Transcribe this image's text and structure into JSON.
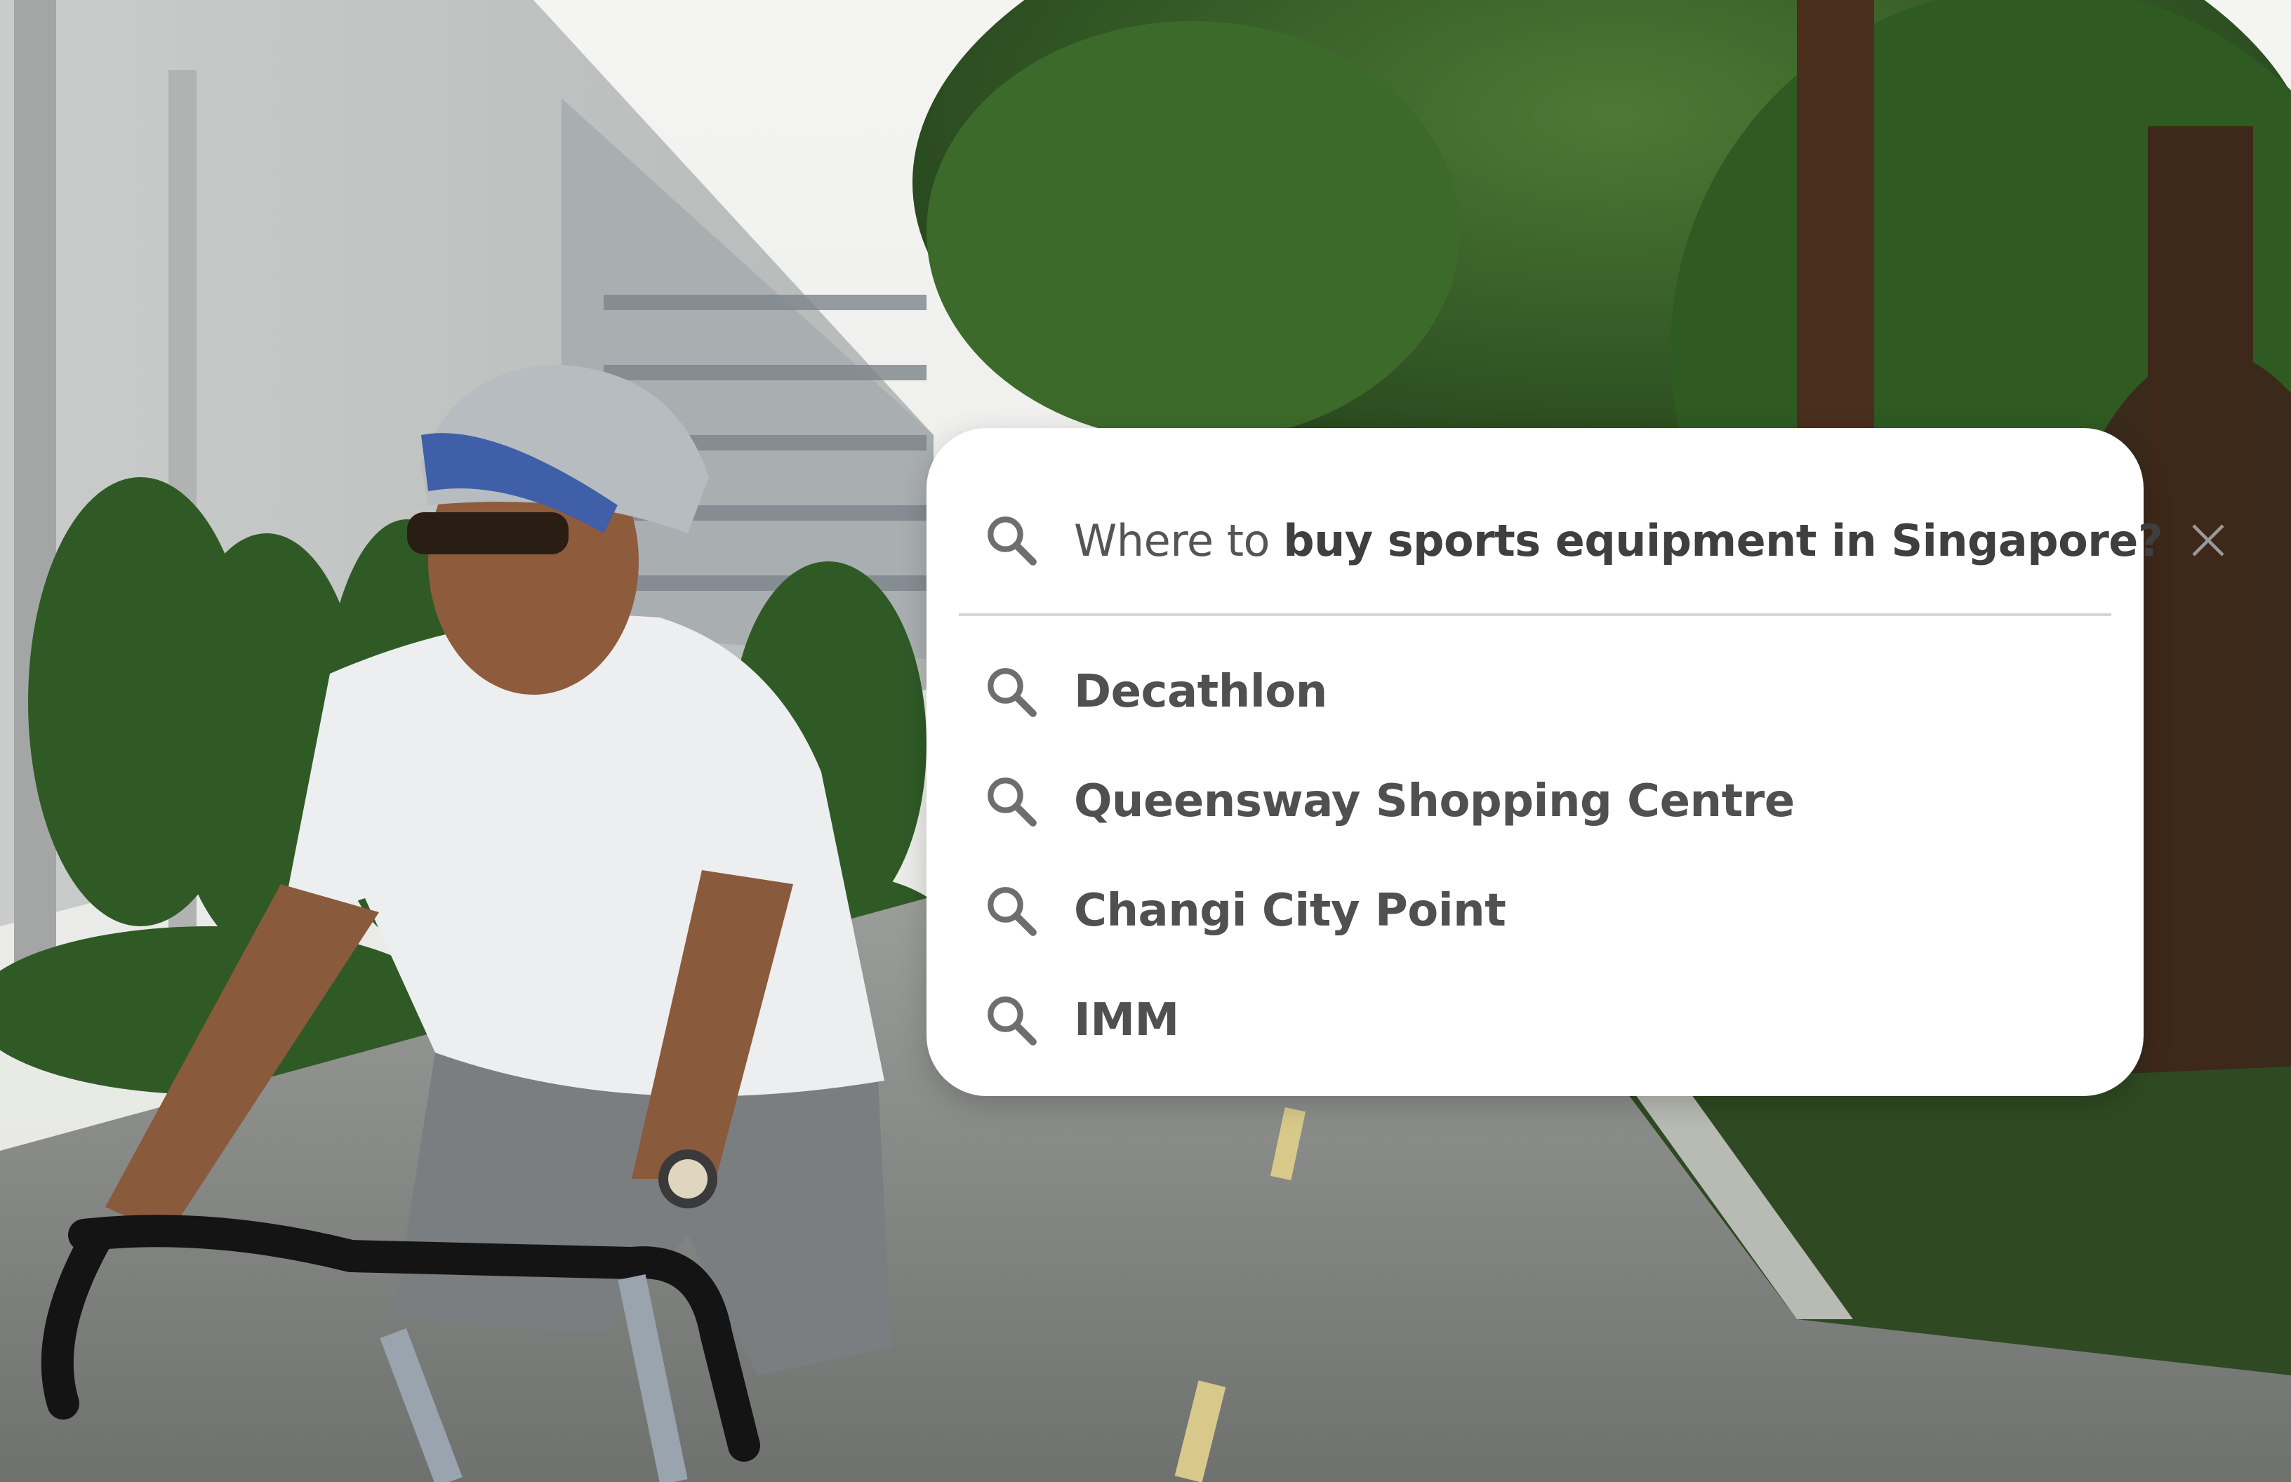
{
  "search": {
    "query_plain": "Where to ",
    "query_bold": "buy sports equipment in Singapore?"
  },
  "suggestions": [
    {
      "label": "Decathlon",
      "icon": "search-icon"
    },
    {
      "label": "Queensway Shopping Centre",
      "icon": "search-icon"
    },
    {
      "label": "Changi City Point",
      "icon": "search-icon"
    },
    {
      "label": "IMM",
      "icon": "search-icon"
    }
  ],
  "icons": {
    "search": "search-icon",
    "clear": "close-icon"
  },
  "colors": {
    "card": "#ffffff",
    "text": "#505050",
    "icon": "#6e6e6e",
    "divider": "#d6d6d6"
  }
}
